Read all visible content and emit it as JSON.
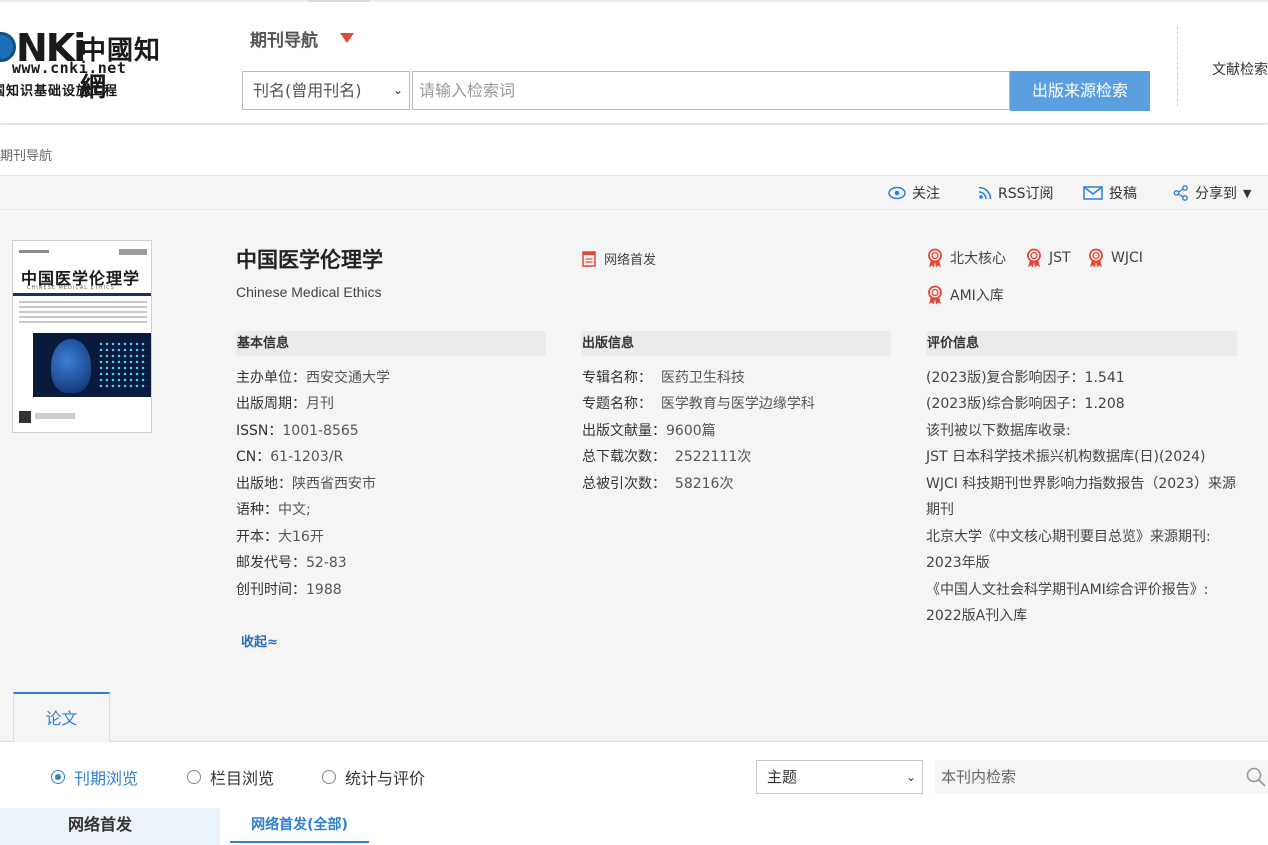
{
  "logo": {
    "cnki_text": "NKi",
    "cn_name": "中國知網",
    "url": "www.cnki.net",
    "subtitle": "国知识基础设施工程"
  },
  "header": {
    "nav_title": "期刊导航",
    "search_field": "刊名(曾用刊名)",
    "search_placeholder": "请输入检索词",
    "search_button": "出版来源检索",
    "doc_search": "文献检索"
  },
  "breadcrumb": "期刊导航",
  "toolbar": {
    "follow": "关注",
    "rss": "RSS订阅",
    "submit": "投稿",
    "share": "分享到"
  },
  "journal": {
    "title": "中国医学伦理学",
    "title_en": "Chinese Medical Ethics",
    "first_online": "网络首发",
    "cover_title": "中国医学伦理学",
    "cover_subtitle": "CHINESE MEDICAL ETHICS"
  },
  "badges": [
    "北大核心",
    "JST",
    "WJCI",
    "AMI入库"
  ],
  "basic_info": {
    "heading": "基本信息",
    "rows": [
      {
        "k": "主办单位：",
        "v": "西安交通大学"
      },
      {
        "k": "出版周期：",
        "v": "月刊"
      },
      {
        "k": "ISSN：",
        "v": "1001-8565"
      },
      {
        "k": "CN：",
        "v": "61-1203/R"
      },
      {
        "k": "出版地：",
        "v": "陕西省西安市"
      },
      {
        "k": "语种：",
        "v": "中文;"
      },
      {
        "k": "开本：",
        "v": "大16开"
      },
      {
        "k": "邮发代号：",
        "v": "52-83"
      },
      {
        "k": "创刊时间：",
        "v": "1988"
      }
    ]
  },
  "pub_info": {
    "heading": "出版信息",
    "rows": [
      {
        "k": "专辑名称：",
        "v": "医药卫生科技"
      },
      {
        "k": "专题名称：",
        "v": "医学教育与医学边缘学科"
      },
      {
        "k": "出版文献量：",
        "v": "9600篇"
      },
      {
        "k": "总下载次数：",
        "v": "2522111次"
      },
      {
        "k": "总被引次数：",
        "v": "58216次"
      }
    ]
  },
  "eval_info": {
    "heading": "评价信息",
    "lines": [
      "(2023版)复合影响因子：1.541",
      "(2023版)综合影响因子：1.208",
      "该刊被以下数据库收录:",
      "JST 日本科学技术振兴机构数据库(日)(2024)",
      "WJCI 科技期刊世界影响力指数报告（2023）来源",
      "期刊",
      "北京大学《中文核心期刊要目总览》来源期刊:",
      "2023年版",
      "《中国人文社会科学期刊AMI综合评价报告》:",
      "2022版A刊入库"
    ]
  },
  "collapse_label": "收起≈",
  "tabs": {
    "papers": "论文"
  },
  "browse": {
    "options": [
      "刊期浏览",
      "栏目浏览",
      "统计与评价"
    ],
    "topic_select": "主题",
    "inner_search_placeholder": "本刊内检索",
    "left_panel": "网络首发",
    "sub_tab": "网络首发(全部)"
  },
  "colors": {
    "accent": "#2f7fd0",
    "search_button": "#5aa0e0",
    "nav_arrow": "#e0483a",
    "badge": "#e0483a"
  }
}
